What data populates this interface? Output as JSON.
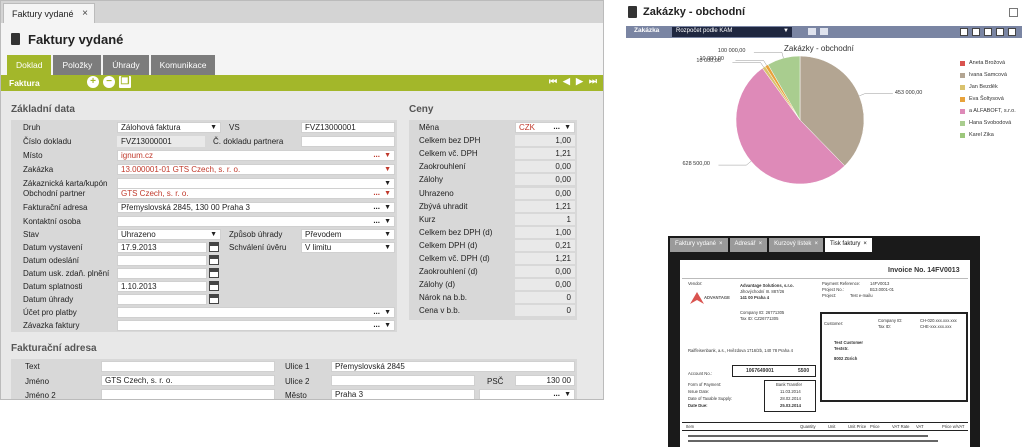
{
  "left": {
    "tab_label": "Faktury vydané",
    "close_glyph": "×",
    "page_title": "Faktury vydané",
    "subtabs": [
      "Doklad",
      "Položky",
      "Úhrady",
      "Komunikace"
    ],
    "bar_label": "Faktura",
    "sections": {
      "basic": "Základní data",
      "prices": "Ceny",
      "address": "Fakturační adresa"
    },
    "basic_labels": [
      "Druh",
      "Číslo dokladu",
      "Místo",
      "Zakázka",
      "Zákaznická karta/kupón",
      "Obchodní partner",
      "Fakturační adresa",
      "Kontaktní osoba",
      "Stav",
      "Datum vystavení",
      "Datum odeslání",
      "Datum usk. zdaň. plnění",
      "Datum splatnosti",
      "Datum úhrady",
      "Účet pro platby",
      "Závazka faktury"
    ],
    "druh_value": "Zálohová faktura",
    "cislo_value": "FVZ13000001",
    "misto_value": "ignum.cz",
    "zakazka_value": "13.000001-01 GTS Czech, s. r. o.",
    "partner_value": "GTS Czech, s. r. o.",
    "adresa_value": "Přemyslovská 2845, 130 00 Praha 3",
    "stav_value": "Uhrazeno",
    "datum_vystaveni": "17.9.2013",
    "datum_splatnosti": "1.10.2013",
    "vs_label": "VS",
    "vs_value": "FVZ13000001",
    "c_partnera_label": "Č. dokladu partnera",
    "zpusob_label": "Způsob úhrady",
    "zpusob_value": "Převodem",
    "schvaleni_label": "Schválení úvěru",
    "schvaleni_value": "V limitu",
    "price_labels": [
      "Měna",
      "Celkem bez DPH",
      "Celkem vč. DPH",
      "Zaokrouhlení",
      "Zálohy",
      "Uhrazeno",
      "Zbývá uhradit",
      "Kurz",
      "Celkem bez DPH (d)",
      "Celkem DPH (d)",
      "Celkem vč. DPH (d)",
      "Zaokrouhlení (d)",
      "Zálohy (d)",
      "Nárok na b.b.",
      "Cena v b.b."
    ],
    "mena_value": "CZK",
    "price_values": [
      "1,00",
      "1,21",
      "0,00",
      "0,00",
      "0,00",
      "1,21",
      "1",
      "1,00",
      "0,21",
      "1,21",
      "0,00",
      "0,00",
      "0",
      "0"
    ],
    "addr_labels": {
      "text": "Text",
      "jmeno": "Jméno",
      "jmeno2": "Jméno 2",
      "ulice1": "Ulice 1",
      "ulice2": "Ulice 2",
      "mesto": "Město",
      "psc": "PSČ"
    },
    "addr_values": {
      "jmeno": "GTS Czech, s. r. o.",
      "ulice1": "Přemyslovská 2845",
      "mesto": "Praha 3",
      "psc": "130 00"
    }
  },
  "chart_panel": {
    "title": "Zakázky - obchodní",
    "filter_label": "Zakázka",
    "filter_value": "Rozpočet podle KAM",
    "dd_glyph": "▼"
  },
  "chart_data": {
    "type": "pie",
    "title": "Zakázky - obchodní",
    "series": [
      {
        "name": "Aneta Brožová",
        "value": 453000,
        "color": "#b3a592"
      },
      {
        "name": "Ivana Samcová",
        "value": 628500,
        "color": "#de8ab8"
      },
      {
        "name": "Jan Bezděk",
        "value": 10000,
        "color": "#d9c26e"
      },
      {
        "name": "Eva Šoltysová",
        "value": 10000,
        "color": "#e8a23b"
      },
      {
        "name": "a ALFABOFT, s.r.o.",
        "value": 100000,
        "color": "#a9cd8f"
      }
    ],
    "data_labels": [
      "453 000,00",
      "628 500,00",
      "10 000,00",
      "10 000,00",
      "100 000,00"
    ],
    "legend": [
      "Aneta Brožová",
      "Ivana Samcová",
      "Jan Bezděk",
      "Eva Šoltysová",
      "a ALFABOFT, s.r.o.",
      "Hana Svobodová",
      "Karel Zika"
    ],
    "legend_colors": [
      "#d9534f",
      "#b3a592",
      "#d9c26e",
      "#e8a23b",
      "#de8ab8",
      "#a9cd8f",
      "#9cc77b"
    ],
    "legend_position": "right"
  },
  "invoice_panel": {
    "tabs": [
      "Faktury vydané",
      "Adresář",
      "Kurzový lístek",
      "Tisk faktury"
    ],
    "close_glyph": "×",
    "heading": "Invoice No. 14FV0013",
    "vendor_label": "Vendor:",
    "company_name": "Advantage Solutions, s.r.o.",
    "company_addr1": "Jihovýchodní III. 887/26",
    "company_addr2": "141 00 Praha 4",
    "company_id": "Company ID: 26771305",
    "tax_id": "Tax ID: CZ26771305",
    "logo_text": "ADVANTAGE",
    "payment_ref": "Payment Reference:",
    "payment_ref_val": "14FV0013",
    "project_no": "Project No.:",
    "project_no_val": "B13.0001-01",
    "project": "Project:",
    "project_val": "Test e-mailu",
    "customer_label": "Customer:",
    "cust_company_id": "Company ID:",
    "cust_company_id_val": "CH-020.xxx.xxx.xxx",
    "cust_tax_id": "Tax ID:",
    "cust_tax_id_val": "CHE-xxx.xxx.xxx",
    "cust_name": "Test Customer",
    "cust_street": "Teststr.",
    "cust_city": "8002  Zürich",
    "bank": "Raiffeisenbank, a.s., Hvězdova 1716/2b, 140 78 Praha 4",
    "account_label": "Account No.:",
    "account_val": "1067649001",
    "bank_code": "5500",
    "form_payment": "Form of Payment:",
    "form_payment_val": "Bank Transfer",
    "issue_date": "Issue Date:",
    "issue_date_val": "11.03.2014",
    "taxable_date": "Date of Taxable Supply:",
    "taxable_date_val": "28.02.2014",
    "due_date": "Date Due:",
    "due_date_val": "25.03.2014",
    "table_headers": [
      "Item",
      "Quantity",
      "Unit",
      "Unit Price",
      "Price",
      "VAT Rate",
      "VAT",
      "Price w/VAT"
    ]
  }
}
